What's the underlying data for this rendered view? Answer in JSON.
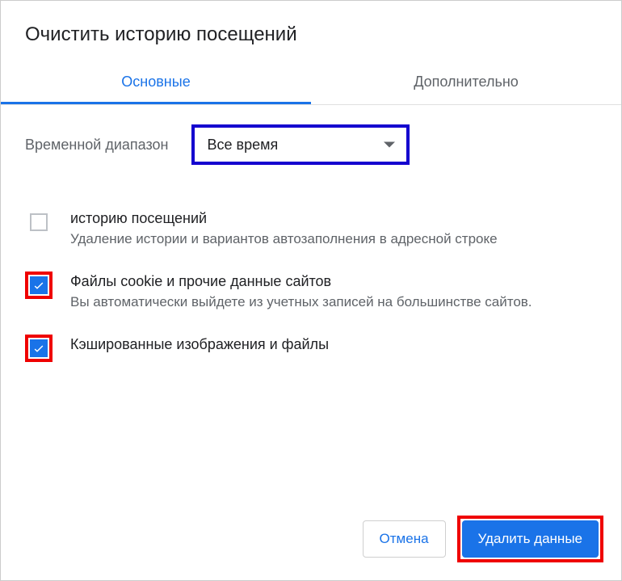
{
  "title": "Очистить историю посещений",
  "tabs": {
    "basic": "Основные",
    "advanced": "Дополнительно"
  },
  "range": {
    "label": "Временной диапазон",
    "value": "Все время"
  },
  "options": [
    {
      "checked": false,
      "highlight": false,
      "title": "историю посещений",
      "sub": "Удаление истории и вариантов автозаполнения в адресной строке"
    },
    {
      "checked": true,
      "highlight": true,
      "title": "Файлы cookie и прочие данные сайтов",
      "sub": "Вы автоматически выйдете из учетных записей на большинстве сайтов."
    },
    {
      "checked": true,
      "highlight": true,
      "title": "Кэшированные изображения и файлы",
      "sub": ""
    }
  ],
  "buttons": {
    "cancel": "Отмена",
    "confirm": "Удалить данные"
  }
}
